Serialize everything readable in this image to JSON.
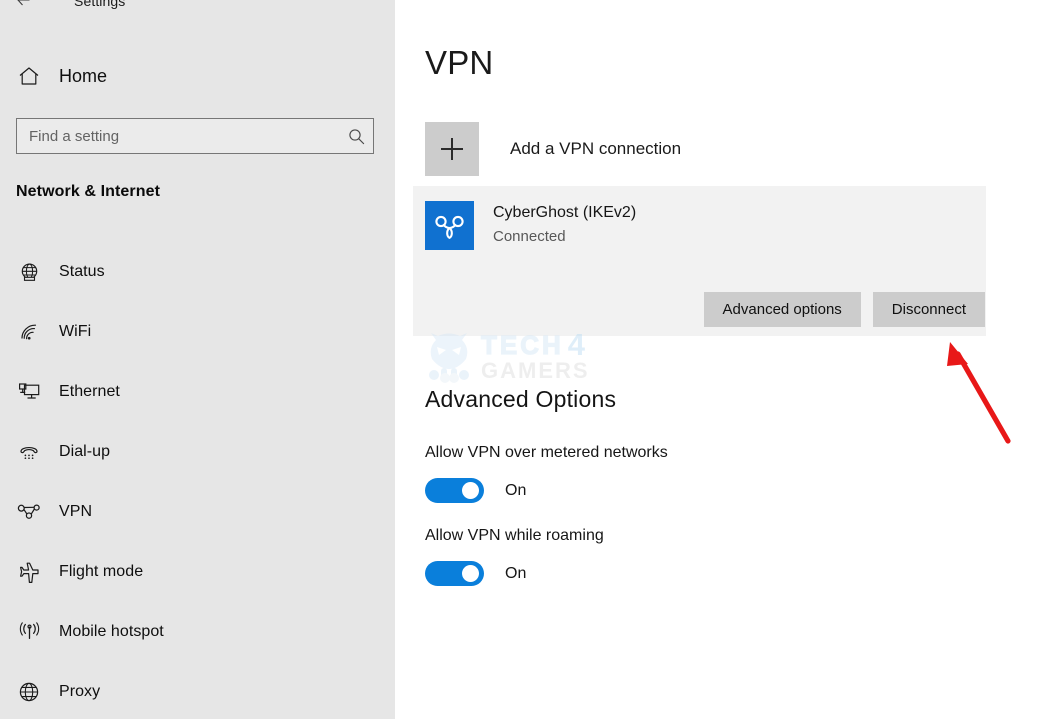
{
  "window": {
    "titlebar_text": "Settings",
    "back_icon": "back-arrow-icon"
  },
  "sidebar": {
    "home_label": "Home",
    "home_icon": "home-icon",
    "search": {
      "placeholder": "Find a setting",
      "value": "",
      "icon": "search-icon"
    },
    "section_title": "Network & Internet",
    "items": [
      {
        "label": "Status",
        "icon": "globe-status-icon",
        "selected": false
      },
      {
        "label": "WiFi",
        "icon": "wifi-icon",
        "selected": false
      },
      {
        "label": "Ethernet",
        "icon": "ethernet-icon",
        "selected": false
      },
      {
        "label": "Dial-up",
        "icon": "dialup-phone-icon",
        "selected": false
      },
      {
        "label": "VPN",
        "icon": "vpn-icon",
        "selected": false
      },
      {
        "label": "Flight mode",
        "icon": "airplane-icon",
        "selected": false
      },
      {
        "label": "Mobile hotspot",
        "icon": "hotspot-icon",
        "selected": false
      },
      {
        "label": "Proxy",
        "icon": "globe-proxy-icon",
        "selected": false
      }
    ]
  },
  "main": {
    "page_title": "VPN",
    "add_connection": {
      "label": "Add a VPN connection",
      "icon": "plus-icon"
    },
    "connection": {
      "name": "CyberGhost (IKEv2)",
      "status": "Connected",
      "logo_icon": "cyberghost-logo-icon",
      "logo_color": "#1071d0",
      "advanced_options_label": "Advanced options",
      "disconnect_label": "Disconnect"
    },
    "advanced": {
      "heading": "Advanced Options",
      "options": [
        {
          "label": "Allow VPN over metered networks",
          "state": "On",
          "on": true
        },
        {
          "label": "Allow VPN while roaming",
          "state": "On",
          "on": true
        }
      ]
    },
    "watermark": {
      "tech": "TECH",
      "four": "4",
      "gamers": "GAMERS",
      "mascot_icon": "mascot-icon"
    },
    "annotation": {
      "arrow_icon": "red-arrow-icon",
      "color": "#e81818"
    }
  }
}
